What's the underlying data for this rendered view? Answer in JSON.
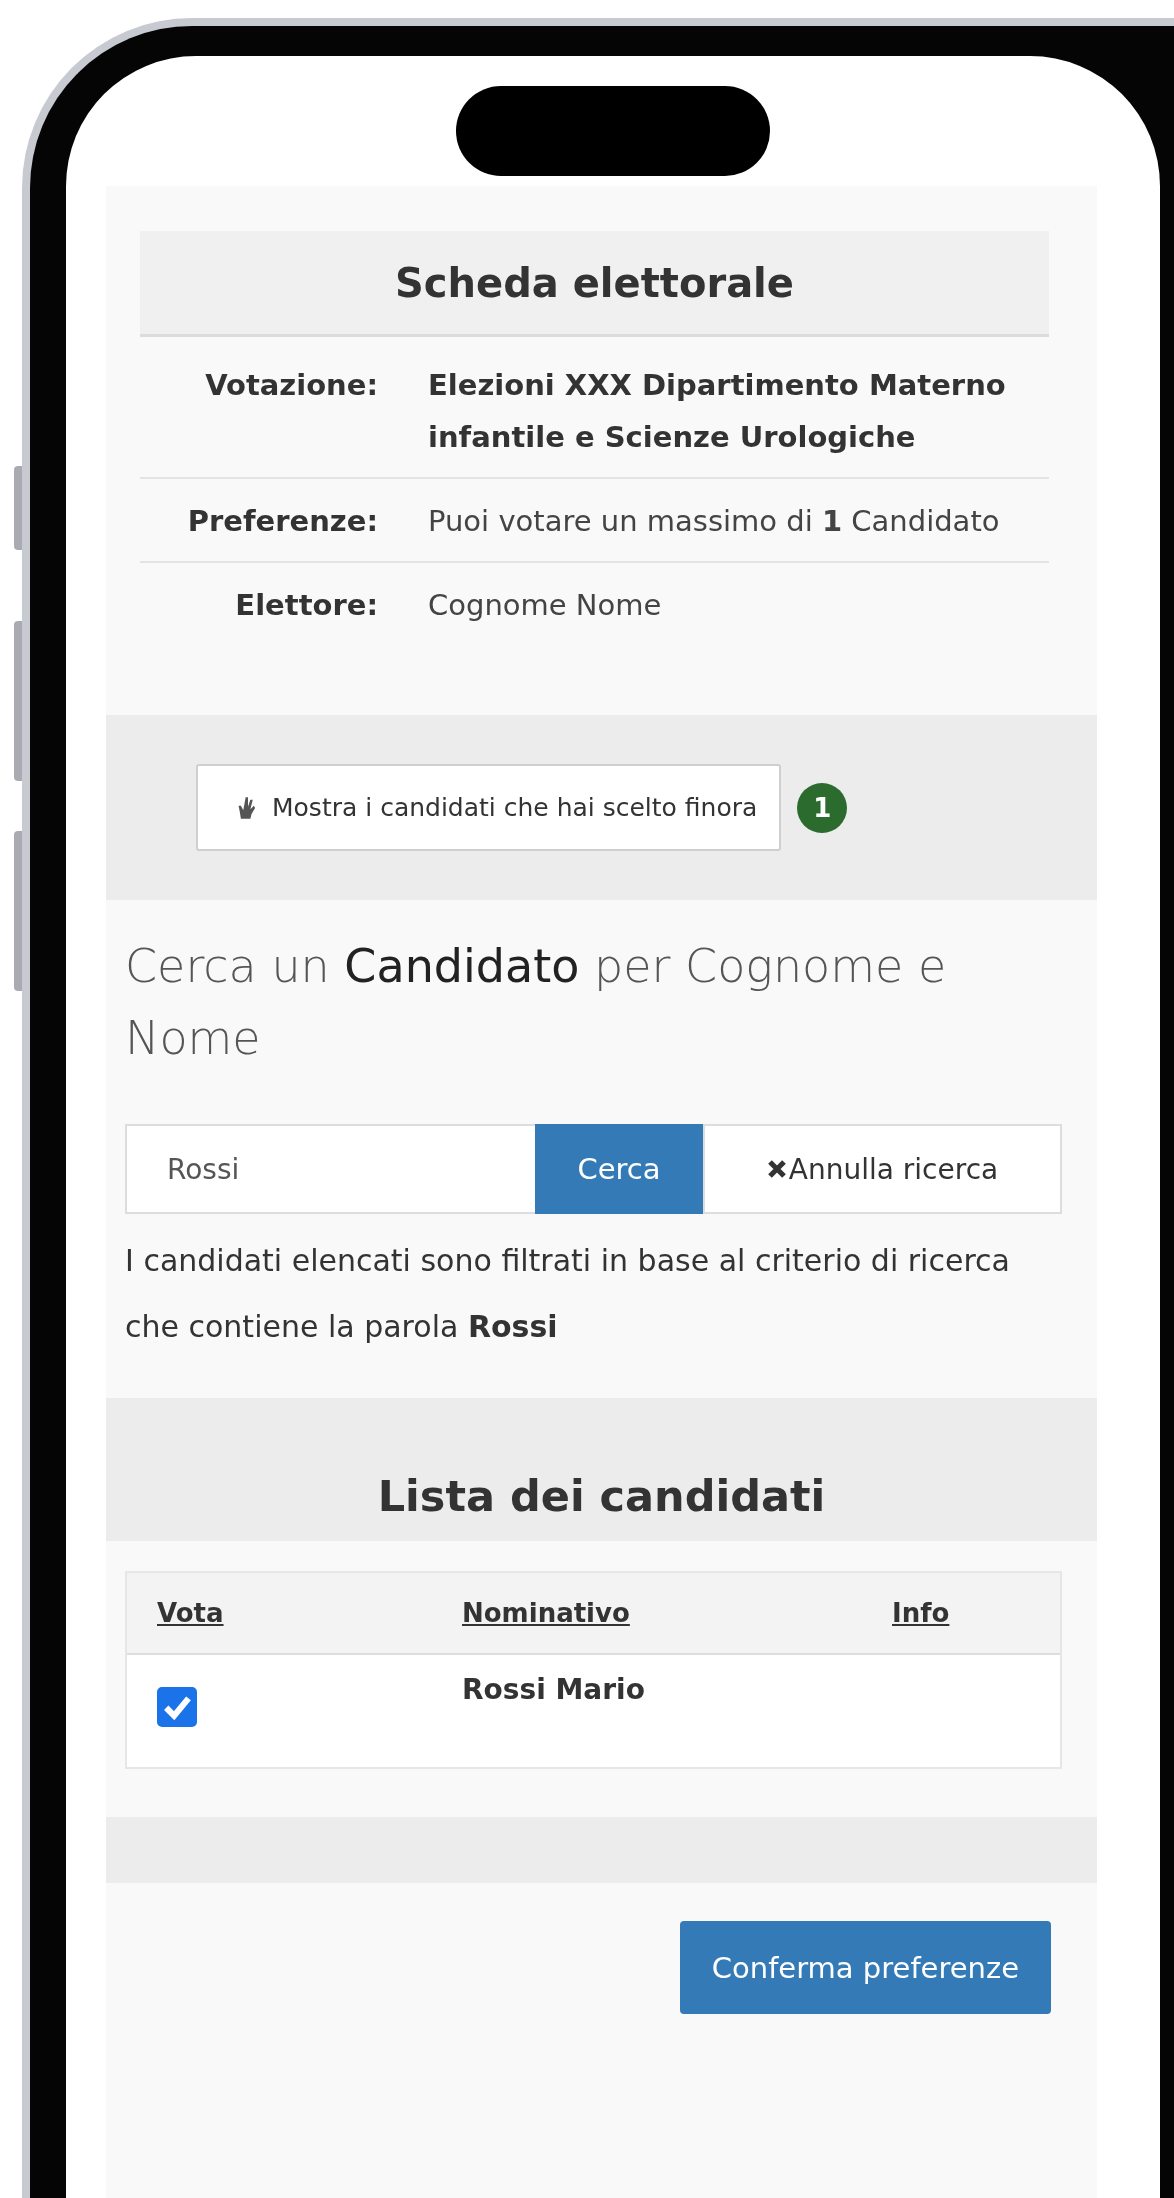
{
  "ballot": {
    "title": "Scheda elettorale",
    "rows": [
      {
        "label": "Votazione:",
        "value": "Elezioni XXX Dipartimento Materno infantile e Scienze Urologiche",
        "bold": true
      },
      {
        "label": "Preferenze:",
        "value": "Puoi votare un massimo di **1** Candidato",
        "bold": false
      },
      {
        "label": "Elettore:",
        "value": "Cognome Nome",
        "bold": false
      }
    ]
  },
  "chosen_button": {
    "label": "Mostra i candidati che hai scelto finora",
    "count": "1"
  },
  "search": {
    "heading": "Cerca un **Candidato** per Cognome e Nome",
    "value": "Rossi",
    "button": "Cerca",
    "clear": "Annulla ricerca",
    "note": "I candidati elencati sono filtrati in base al criterio di ricerca che contiene la parola **Rossi**"
  },
  "candidates": {
    "title": "Lista dei candidati",
    "columns": [
      "Vota",
      "Nominativo",
      "Info"
    ],
    "rows": [
      {
        "name": "Rossi Mario",
        "checked": true
      }
    ]
  },
  "confirm_button": "Conferma preferenze"
}
